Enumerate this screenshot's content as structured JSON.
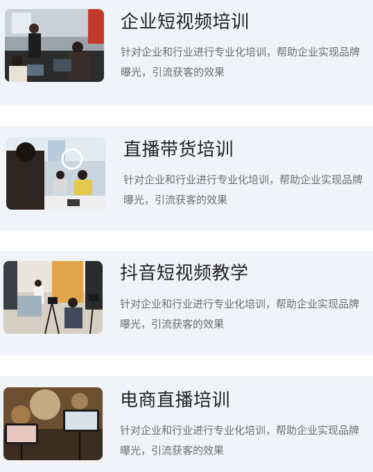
{
  "services": [
    {
      "title": "企业短视频培训",
      "description": "针对企业和行业进行专业化培训，帮助企业实现品牌曝光，引流获客的效果",
      "image_icon": "office-training-photo-icon"
    },
    {
      "title": "直播带货培训",
      "description": "针对企业和行业进行专业化培训，帮助企业实现品牌曝光，引流获客的效果",
      "image_icon": "live-stream-training-photo-icon"
    },
    {
      "title": "抖音短视频教学",
      "description": "针对企业和行业进行专业化培训，帮助企业实现品牌曝光，引流获客的效果",
      "image_icon": "video-shooting-photo-icon"
    },
    {
      "title": "电商直播培训",
      "description": "针对企业和行业进行专业化培训，帮助企业实现品牌曝光，引流获客的效果",
      "image_icon": "ecommerce-live-photo-icon"
    }
  ],
  "colors": {
    "card_background": "#f0f3f8",
    "title_text": "#222222",
    "description_text": "#6e6e6e"
  }
}
